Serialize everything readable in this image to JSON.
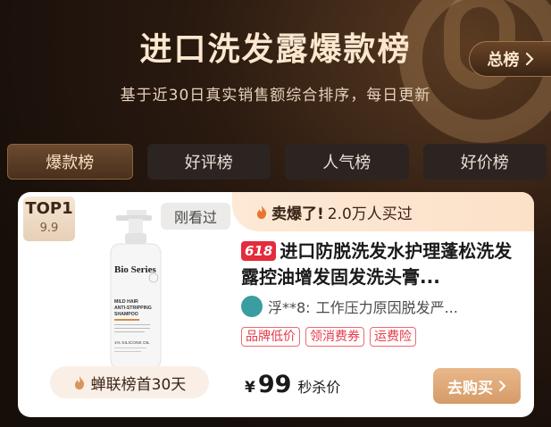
{
  "header": {
    "title": "进口洗发露爆款榜",
    "subtitle": "基于近30日真实销售额综合排序，每日更新",
    "all_ranks_label": "总榜"
  },
  "tabs": [
    {
      "label": "爆款榜",
      "active": true
    },
    {
      "label": "好评榜",
      "active": false
    },
    {
      "label": "人气榜",
      "active": false
    },
    {
      "label": "好价榜",
      "active": false
    }
  ],
  "product": {
    "rank_label": "TOP1",
    "rank_score": "9.9",
    "viewed_label": "刚看过",
    "hot_emphasis": "卖爆了!",
    "hot_count": "2.0万人买过",
    "promo_badge": "618",
    "title": "进口防脱洗发水护理蓬松洗发露控油增发固发洗头膏...",
    "review_user": "浮**8:",
    "review_text": "工作压力原因脱发严...",
    "tags": [
      "品牌低价",
      "领消费券",
      "运费险"
    ],
    "price_currency": "¥",
    "price_value": "99",
    "price_label": "秒杀价",
    "buy_label": "去购买",
    "rank_days_label": "蝉联榜首30天",
    "bottle_brand": "Bio Series",
    "bottle_line1": "MILD HAIR",
    "bottle_line2": "ANTI-STRIPPING",
    "bottle_line3": "SHAMPOO",
    "bottle_line4": "1% SILICONE OIL"
  },
  "colors": {
    "accent_gold": "#d69b68",
    "promo_red": "#e42c3c",
    "tag_red": "#e4394a"
  }
}
